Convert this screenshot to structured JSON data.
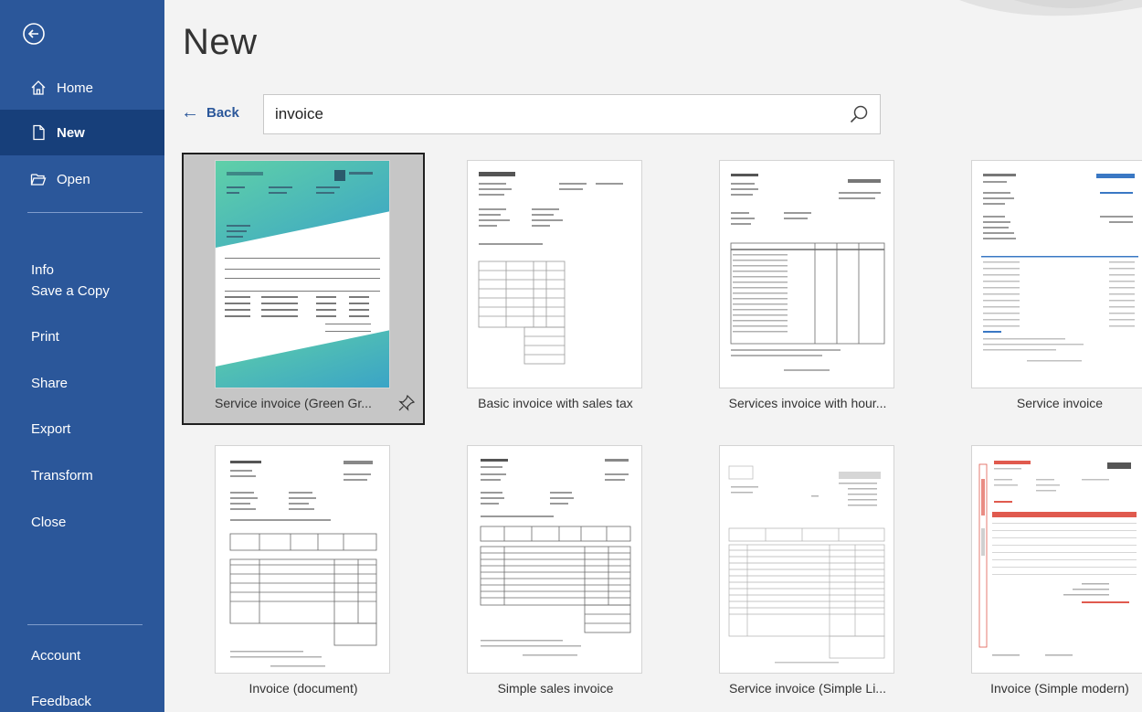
{
  "sidebar": {
    "items": [
      {
        "label": "Home"
      },
      {
        "label": "New"
      },
      {
        "label": "Open"
      },
      {
        "label": "Info"
      },
      {
        "label": "Save a Copy"
      },
      {
        "label": "Print"
      },
      {
        "label": "Share"
      },
      {
        "label": "Export"
      },
      {
        "label": "Transform"
      },
      {
        "label": "Close"
      },
      {
        "label": "Account"
      },
      {
        "label": "Feedback"
      }
    ]
  },
  "main": {
    "title": "New",
    "back_label": "Back",
    "search": {
      "value": "invoice"
    }
  },
  "templates": [
    {
      "label": "Service invoice (Green Gr...",
      "selected": true
    },
    {
      "label": "Basic invoice with sales tax"
    },
    {
      "label": "Services invoice with hour..."
    },
    {
      "label": "Service invoice"
    },
    {
      "label": "Invoice (document)"
    },
    {
      "label": "Simple sales invoice"
    },
    {
      "label": "Service invoice (Simple Li..."
    },
    {
      "label": "Invoice (Simple modern)"
    }
  ],
  "colors": {
    "sidebar": "#2b579a",
    "sidebar_active": "#173f7a",
    "accent": "#2b579a"
  }
}
